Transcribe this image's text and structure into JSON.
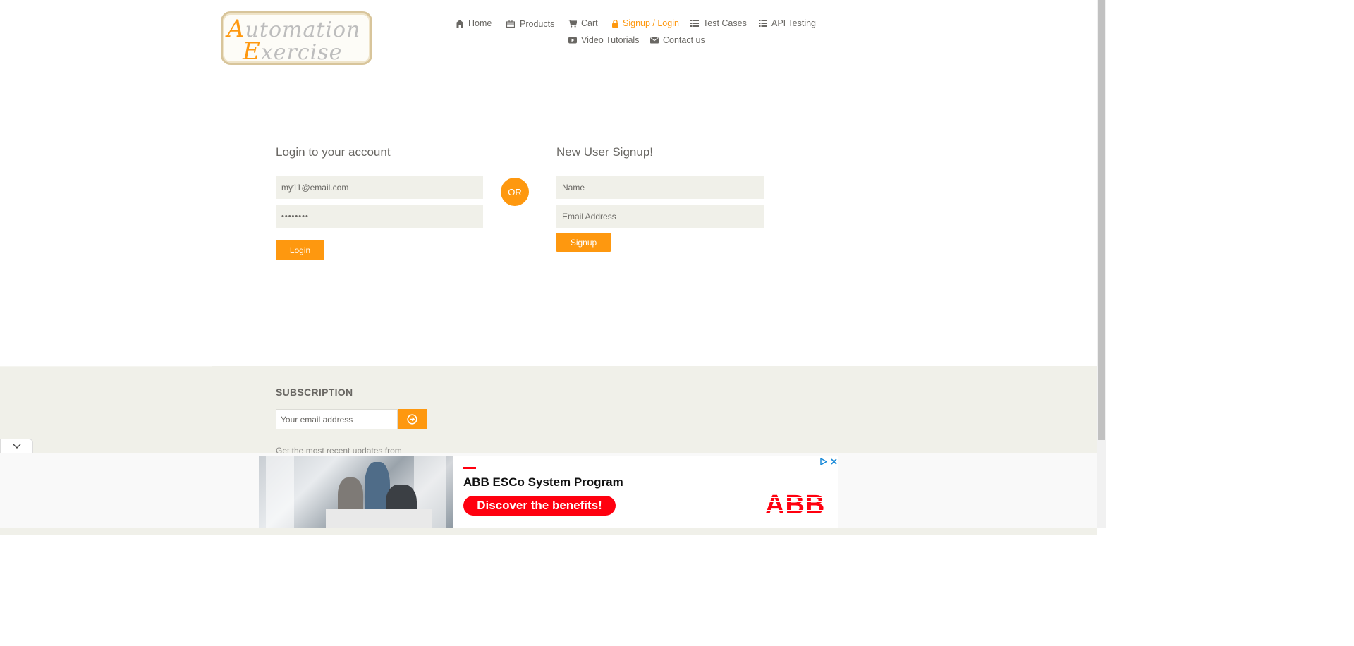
{
  "colors": {
    "accent": "#fe980f",
    "field_bg": "#f0f0e9",
    "text": "#696763",
    "ad_red": "#ff000f"
  },
  "logo": {
    "line1_first": "A",
    "line1_rest": "utomation",
    "line2_first": "E",
    "line2_rest": "xercise"
  },
  "nav": [
    {
      "label": "Home",
      "icon": "home-icon"
    },
    {
      "label": "Products",
      "icon": "products-icon"
    },
    {
      "label": "Cart",
      "icon": "cart-icon"
    },
    {
      "label": "Signup / Login",
      "icon": "lock-icon",
      "active": true
    },
    {
      "label": "Test Cases",
      "icon": "list-icon"
    },
    {
      "label": "API Testing",
      "icon": "list-icon"
    },
    {
      "label": "Video Tutorials",
      "icon": "youtube-icon"
    },
    {
      "label": "Contact us",
      "icon": "envelope-icon"
    }
  ],
  "login": {
    "title": "Login to your account",
    "email_value": "my11@email.com",
    "password_value": "••••••••",
    "button": "Login"
  },
  "or_label": "OR",
  "signup": {
    "title": "New User Signup!",
    "name_placeholder": "Name",
    "email_placeholder": "Email Address",
    "button": "Signup"
  },
  "subscription": {
    "title": "SUBSCRIPTION",
    "email_placeholder": "Your email address",
    "note": "Get the most recent updates from"
  },
  "ad": {
    "headline": "ABB ESCo System Program",
    "cta": "Discover the benefits!",
    "brand": "ABB"
  }
}
